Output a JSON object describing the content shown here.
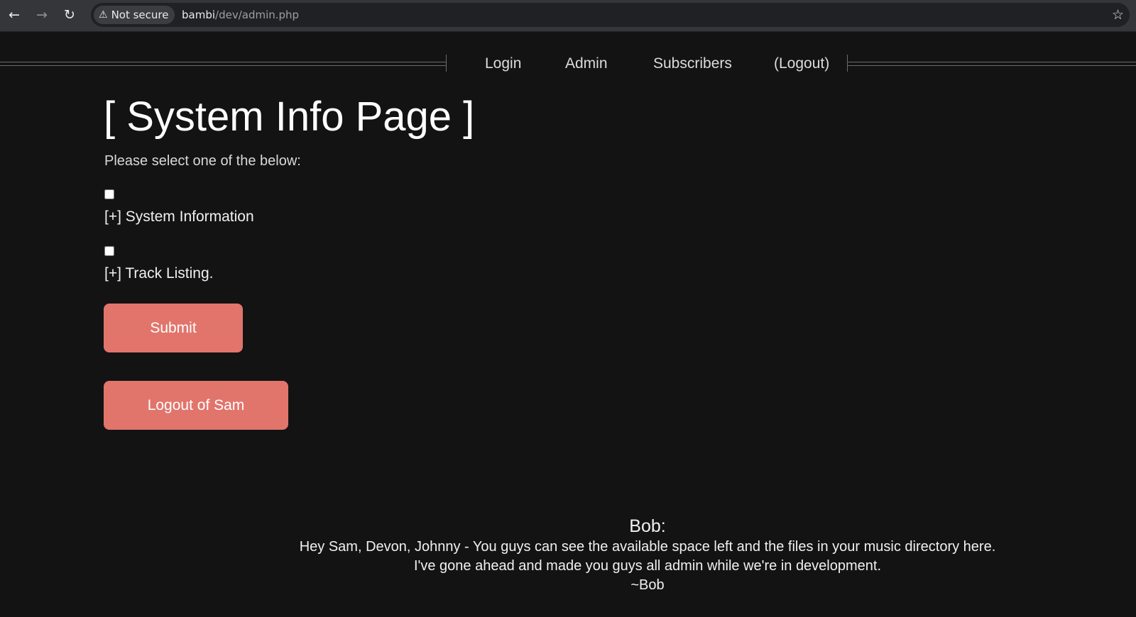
{
  "browser": {
    "back_icon": "arrow-left-icon",
    "forward_icon": "arrow-right-icon",
    "reload_icon": "reload-icon",
    "security_label": "Not secure",
    "url_host": "bambi",
    "url_path": "/dev/admin.php",
    "bookmark_icon": "star-icon"
  },
  "nav": {
    "links": [
      "Login",
      "Admin",
      "Subscribers",
      "(Logout)"
    ]
  },
  "main": {
    "title": "[ System Info Page ]",
    "subtitle": "Please select one of the below:",
    "options": [
      {
        "label": "[+] System Information",
        "checked": false
      },
      {
        "label": "[+] Track Listing.",
        "checked": false
      }
    ],
    "submit_label": "Submit",
    "logout_label": "Logout of Sam"
  },
  "note": {
    "author": "Bob:",
    "lines": [
      "Hey Sam, Devon, Johnny - You guys can see the available space left and the files in your music directory here.",
      "I've gone ahead and made you guys all admin while we're in development.",
      "~Bob"
    ]
  },
  "colors": {
    "page_bg": "#131313",
    "button_bg": "#e1756c",
    "chrome_bg": "#35363a"
  }
}
